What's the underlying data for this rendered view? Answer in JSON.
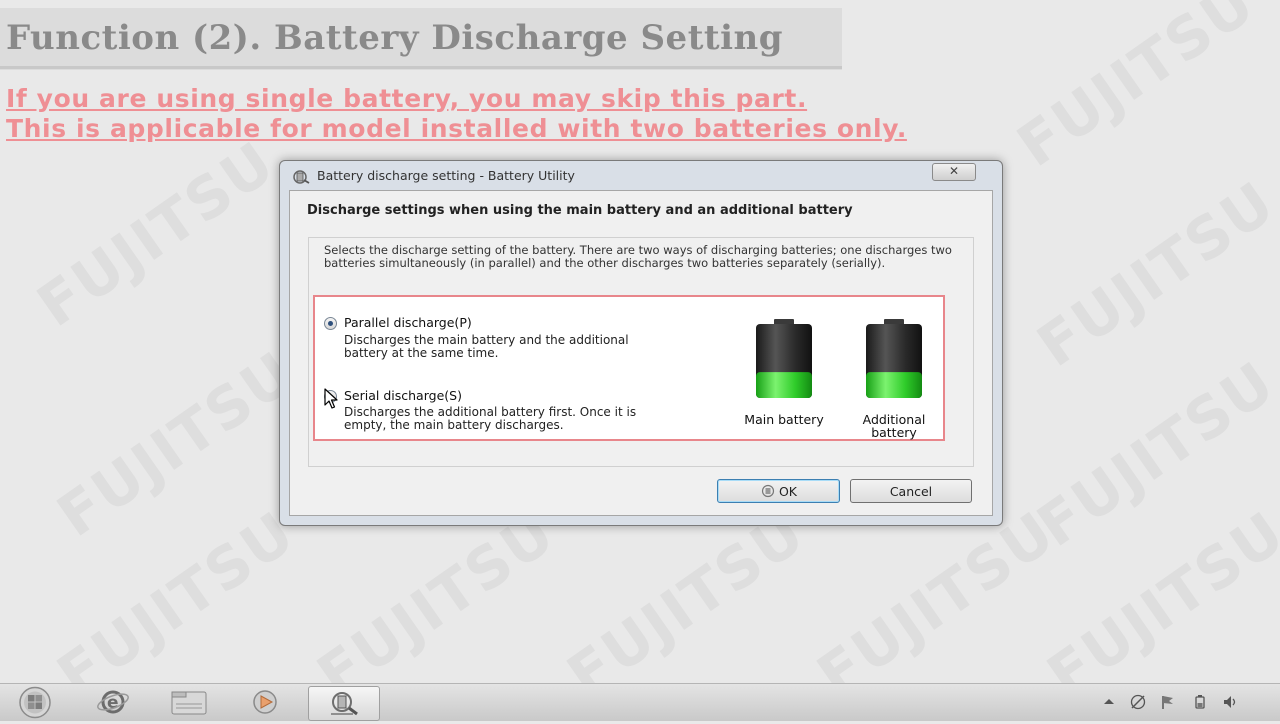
{
  "slide": {
    "title": "Function (2). Battery Discharge Setting",
    "note_line1": "If you are using single battery, you may skip this part.",
    "note_line2": "This is applicable for model installed with two batteries only.",
    "watermark": "FUJITSU"
  },
  "dialog": {
    "title": "Battery discharge setting - Battery Utility",
    "close_label": "✕",
    "heading": "Discharge settings when using the main battery and an additional battery",
    "description": "Selects the discharge setting of the battery. There are two ways of discharging batteries; one discharges two batteries simultaneously (in parallel) and the other discharges two batteries separately (serially).",
    "options": [
      {
        "label": "Parallel discharge(P)",
        "description_line1": "Discharges the main battery and the additional",
        "description_line2": "battery at the same time.",
        "selected": true
      },
      {
        "label": "Serial discharge(S)",
        "description_line1": "Discharges the additional battery first. Once it is",
        "description_line2": "empty, the main battery discharges.",
        "selected": false
      }
    ],
    "batteries": [
      {
        "label": "Main battery",
        "charge_fraction": 0.35
      },
      {
        "label_line1": "Additional",
        "label_line2": "battery",
        "charge_fraction": 0.35
      }
    ],
    "ok_label": "OK",
    "cancel_label": "Cancel"
  },
  "colors": {
    "note": "#ef8f94",
    "options_border": "#e8868b",
    "battery_charge": "#3ed43a"
  },
  "taskbar": {
    "items": [
      "start-orb",
      "internet-explorer-icon",
      "file-explorer-icon",
      "media-player-icon",
      "battery-utility-icon"
    ],
    "tray_icons": [
      "show-hidden-icons-arrow",
      "network-icon",
      "action-center-flag-icon",
      "power-icon",
      "volume-icon"
    ]
  }
}
